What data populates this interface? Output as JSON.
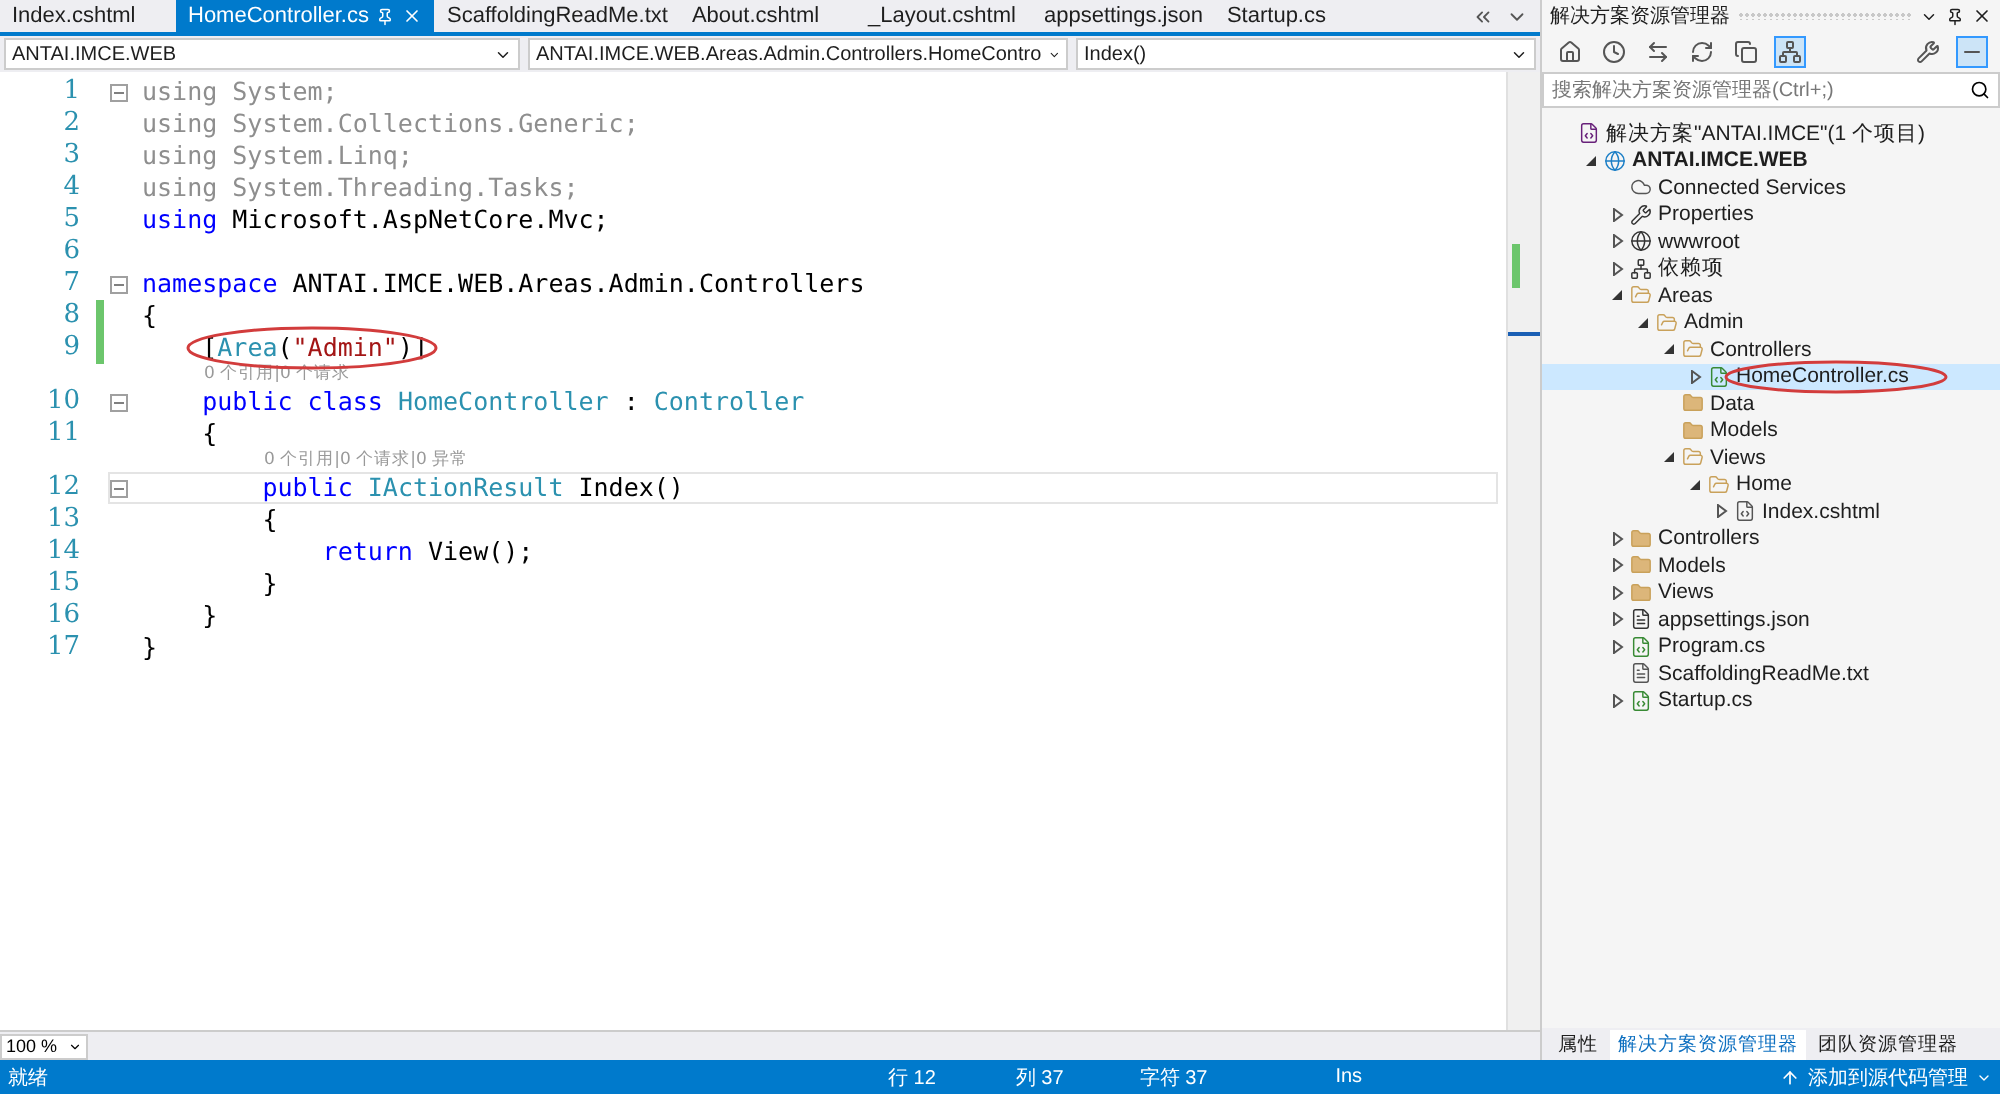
{
  "editor_tabs": [
    {
      "label": "Index.cshtml",
      "selected": false
    },
    {
      "label": "HomeController.cs",
      "selected": true
    },
    {
      "label": "ScaffoldingReadMe.txt",
      "selected": false
    },
    {
      "label": "About.cshtml",
      "selected": false
    },
    {
      "label": "_Layout.cshtml",
      "selected": false
    },
    {
      "label": "appsettings.json",
      "selected": false
    },
    {
      "label": "Startup.cs",
      "selected": false
    }
  ],
  "nav_bar": {
    "project": "ANTAI.IMCE.WEB",
    "type": "ANTAI.IMCE.WEB.Areas.Admin.Controllers.HomeContro",
    "member": "Index()"
  },
  "code_lines": [
    {
      "kind": "code",
      "number": "1",
      "fold": true,
      "changed": false,
      "current": false,
      "tokens": [
        {
          "text": "using System;",
          "kind": "faded"
        }
      ]
    },
    {
      "kind": "code",
      "number": "2",
      "fold": false,
      "changed": false,
      "current": false,
      "tokens": [
        {
          "text": "using System.Collections.Generic;",
          "kind": "faded"
        }
      ]
    },
    {
      "kind": "code",
      "number": "3",
      "fold": false,
      "changed": false,
      "current": false,
      "tokens": [
        {
          "text": "using System.Linq;",
          "kind": "faded"
        }
      ]
    },
    {
      "kind": "code",
      "number": "4",
      "fold": false,
      "changed": false,
      "current": false,
      "tokens": [
        {
          "text": "using System.Threading.Tasks;",
          "kind": "faded"
        }
      ]
    },
    {
      "kind": "code",
      "number": "5",
      "fold": false,
      "changed": false,
      "current": false,
      "tokens": [
        {
          "text": "using",
          "kind": "keyword"
        },
        {
          "text": " Microsoft.AspNetCore.Mvc;",
          "kind": "plain"
        }
      ]
    },
    {
      "kind": "code",
      "number": "6",
      "fold": false,
      "changed": false,
      "current": false
    },
    {
      "kind": "code",
      "number": "7",
      "fold": true,
      "changed": false,
      "current": false,
      "tokens": [
        {
          "text": "namespace",
          "kind": "keyword"
        },
        {
          "text": " ANTAI.IMCE.WEB.Areas.Admin.Controllers",
          "kind": "plain"
        }
      ]
    },
    {
      "kind": "code",
      "number": "8",
      "fold": false,
      "changed": true,
      "current": false,
      "tokens": [
        {
          "text": "{",
          "kind": "plain"
        }
      ]
    },
    {
      "kind": "code",
      "number": "9",
      "fold": false,
      "changed": true,
      "current": false,
      "circled": true,
      "tokens": [
        {
          "text": "    [",
          "kind": "plain"
        },
        {
          "text": "Area",
          "kind": "type"
        },
        {
          "text": "(",
          "kind": "plain"
        },
        {
          "text": "\"Admin\"",
          "kind": "string"
        },
        {
          "text": ")]",
          "kind": "plain"
        }
      ]
    },
    {
      "kind": "lens",
      "text": "0 个引用|0 个请求"
    },
    {
      "kind": "code",
      "number": "10",
      "fold": true,
      "changed": false,
      "current": false,
      "tokens": [
        {
          "text": "    public class ",
          "kind": "keyword"
        },
        {
          "text": "HomeController",
          "kind": "type"
        },
        {
          "text": " : ",
          "kind": "plain"
        },
        {
          "text": "Controller",
          "kind": "type"
        }
      ]
    },
    {
      "kind": "code",
      "number": "11",
      "fold": false,
      "changed": false,
      "current": false,
      "tokens": [
        {
          "text": "    {",
          "kind": "plain"
        }
      ]
    },
    {
      "kind": "lens",
      "text": "0 个引用|0 个请求|0 异常"
    },
    {
      "kind": "code",
      "number": "12",
      "fold": true,
      "changed": false,
      "current": true,
      "tokens": [
        {
          "text": "        public ",
          "kind": "keyword"
        },
        {
          "text": "IActionResult",
          "kind": "type"
        },
        {
          "text": " Index()",
          "kind": "plain"
        }
      ]
    },
    {
      "kind": "code",
      "number": "13",
      "fold": false,
      "changed": false,
      "current": false,
      "tokens": [
        {
          "text": "        {",
          "kind": "plain"
        }
      ]
    },
    {
      "kind": "code",
      "number": "14",
      "fold": false,
      "changed": false,
      "current": false,
      "tokens": [
        {
          "text": "            return",
          "kind": "keyword"
        },
        {
          "text": " View();",
          "kind": "plain"
        }
      ]
    },
    {
      "kind": "code",
      "number": "15",
      "fold": false,
      "changed": false,
      "current": false,
      "tokens": [
        {
          "text": "        }",
          "kind": "plain"
        }
      ]
    },
    {
      "kind": "code",
      "number": "16",
      "fold": false,
      "changed": false,
      "current": false,
      "tokens": [
        {
          "text": "    }",
          "kind": "plain"
        }
      ]
    },
    {
      "kind": "code",
      "number": "17",
      "fold": false,
      "changed": false,
      "current": false,
      "tokens": [
        {
          "text": "}",
          "kind": "plain"
        }
      ]
    }
  ],
  "zoom": "100 %",
  "explorer": {
    "title": "解决方案资源管理器",
    "search": {
      "placeholder": "搜索解决方案资源管理器(Ctrl+;)"
    },
    "tree": [
      {
        "label": "解决方案\"ANTAI.IMCE\"(1 个项目)",
        "kind": "solution",
        "selected": false,
        "children": [
          {
            "label": "ANTAI.IMCE.WEB",
            "kind": "project",
            "expanded": true,
            "selected": false,
            "children": [
              {
                "label": "Connected Services",
                "kind": "cloud",
                "selected": false
              },
              {
                "label": "Properties",
                "kind": "wrench",
                "expanded": false,
                "selected": false
              },
              {
                "label": "wwwroot",
                "kind": "globe",
                "expanded": false,
                "selected": false
              },
              {
                "label": "依赖项",
                "kind": "deps",
                "expanded": false,
                "selected": false
              },
              {
                "label": "Areas",
                "kind": "folder-open",
                "expanded": true,
                "selected": false,
                "children": [
                  {
                    "label": "Admin",
                    "kind": "folder-open",
                    "expanded": true,
                    "selected": false,
                    "children": [
                      {
                        "label": "Controllers",
                        "kind": "folder-open",
                        "expanded": true,
                        "selected": false,
                        "children": [
                          {
                            "label": "HomeController.cs",
                            "kind": "cs",
                            "expanded": false,
                            "selected": true,
                            "circled": true
                          }
                        ]
                      },
                      {
                        "label": "Data",
                        "kind": "folder",
                        "selected": false
                      },
                      {
                        "label": "Models",
                        "kind": "folder",
                        "selected": false
                      },
                      {
                        "label": "Views",
                        "kind": "folder-open",
                        "expanded": true,
                        "selected": false,
                        "children": [
                          {
                            "label": "Home",
                            "kind": "folder-open",
                            "expanded": true,
                            "selected": false,
                            "children": [
                              {
                                "label": "Index.cshtml",
                                "kind": "cshtml",
                                "expanded": false,
                                "selected": false
                              }
                            ]
                          }
                        ]
                      }
                    ]
                  }
                ]
              },
              {
                "label": "Controllers",
                "kind": "folder",
                "expanded": false,
                "selected": false
              },
              {
                "label": "Models",
                "kind": "folder",
                "expanded": false,
                "selected": false
              },
              {
                "label": "Views",
                "kind": "folder",
                "expanded": false,
                "selected": false
              },
              {
                "label": "appsettings.json",
                "kind": "json",
                "expanded": false,
                "selected": false
              },
              {
                "label": "Program.cs",
                "kind": "cs",
                "expanded": false,
                "selected": false
              },
              {
                "label": "ScaffoldingReadMe.txt",
                "kind": "txt",
                "selected": false
              },
              {
                "label": "Startup.cs",
                "kind": "cs",
                "expanded": false,
                "selected": false
              }
            ]
          }
        ]
      }
    ],
    "bottom_tabs": [
      {
        "label": "属性",
        "selected": false
      },
      {
        "label": "解决方案资源管理器",
        "selected": true
      },
      {
        "label": "团队资源管理器",
        "selected": false
      }
    ]
  },
  "status_bar": {
    "state": "就绪",
    "line": "行 12",
    "column": "列 37",
    "char": "字符 37",
    "mode": "Ins",
    "source_control": "添加到源代码管理"
  }
}
